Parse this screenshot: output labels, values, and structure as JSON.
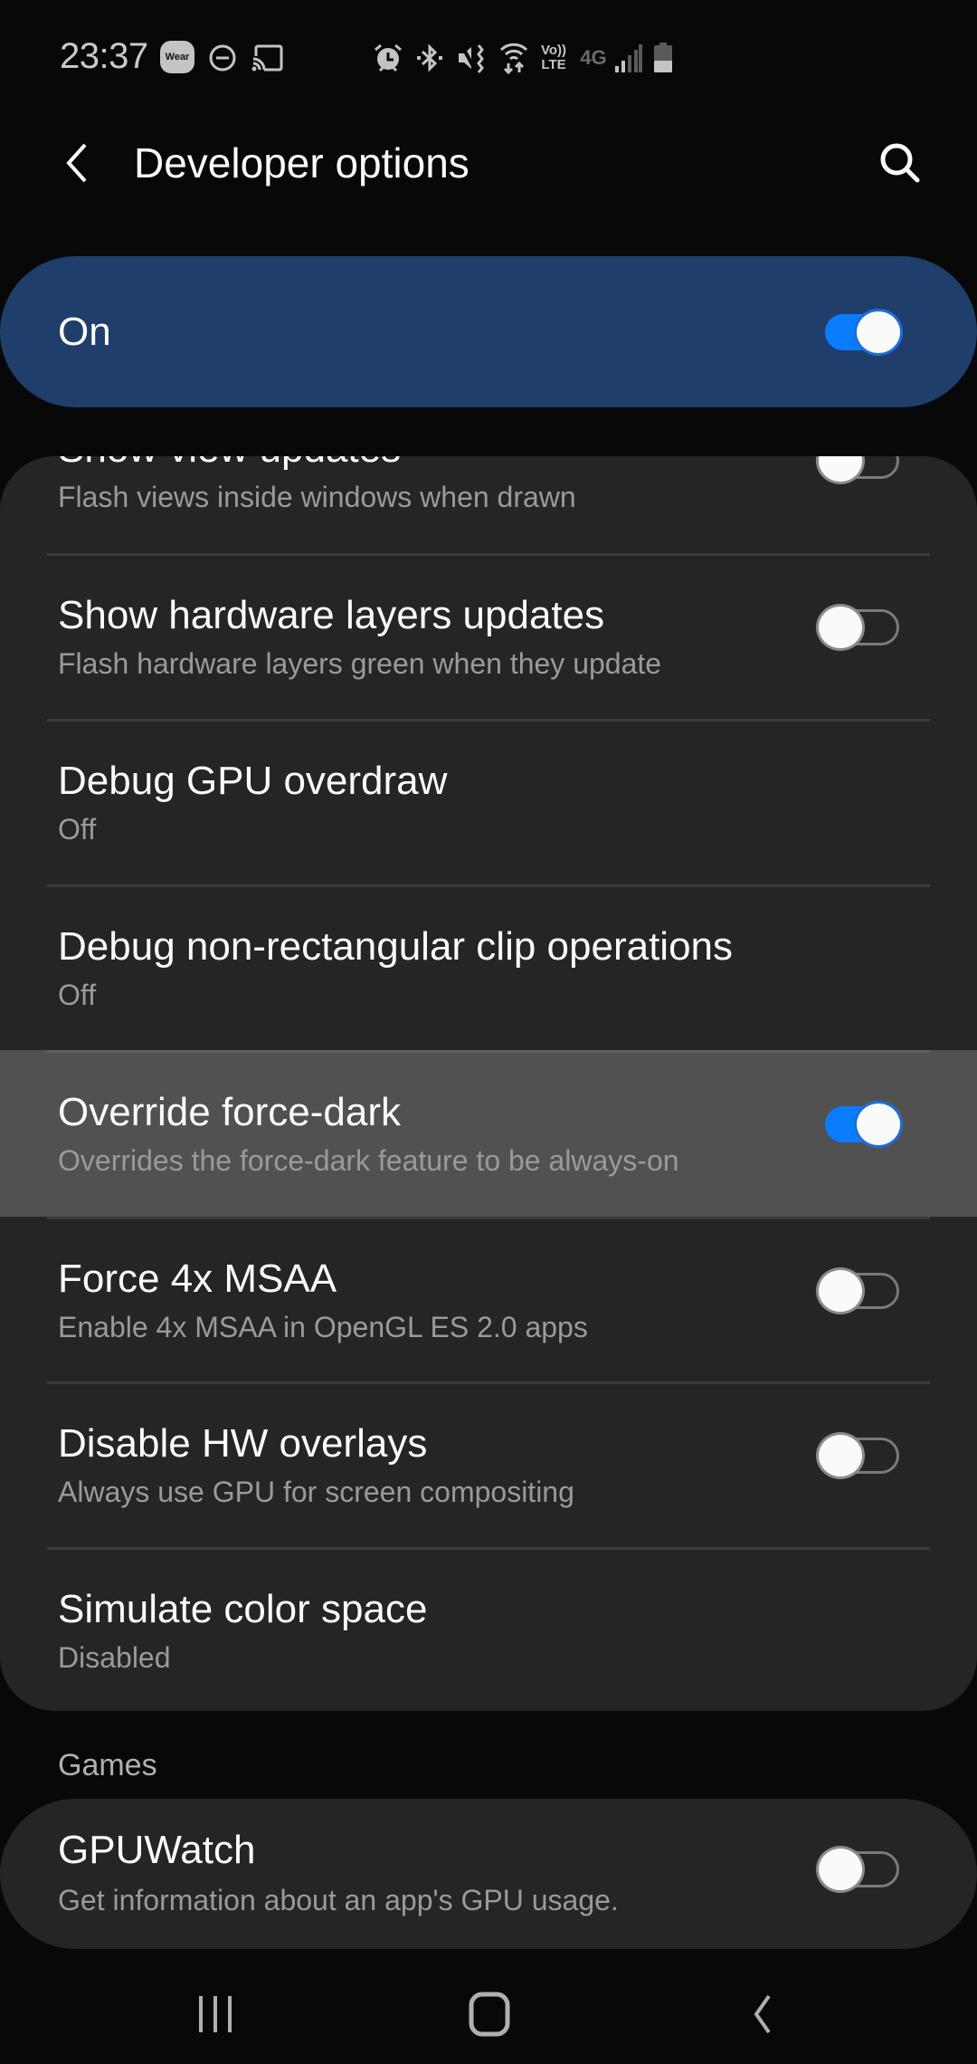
{
  "status_bar": {
    "time": "23:37",
    "wear_badge": "Wear",
    "icons": [
      "wear-icon",
      "do-not-disturb-icon",
      "cast-icon",
      "alarm-icon",
      "bluetooth-icon",
      "vibrate-mute-icon",
      "wifi-icon",
      "volte-icon",
      "4g-lte-icon",
      "signal-icon",
      "battery-icon"
    ],
    "volte_top": "Vo))",
    "volte_bottom": "LTE",
    "network": "4G"
  },
  "header": {
    "title": "Developer options",
    "back_icon": "back-arrow-icon",
    "search_icon": "search-icon"
  },
  "master_switch": {
    "label": "On",
    "enabled": true
  },
  "settings": [
    {
      "title": "Show view updates",
      "subtitle": "Flash views inside windows when drawn",
      "toggle": "off"
    },
    {
      "title": "Show hardware layers updates",
      "subtitle": "Flash hardware layers green when they update",
      "toggle": "off"
    },
    {
      "title": "Debug GPU overdraw",
      "subtitle": "Off",
      "toggle": null
    },
    {
      "title": "Debug non-rectangular clip operations",
      "subtitle": "Off",
      "toggle": null
    },
    {
      "title": "Override force-dark",
      "subtitle": "Overrides the force-dark feature to be always-on",
      "toggle": "on",
      "highlighted": true
    },
    {
      "title": "Force 4x MSAA",
      "subtitle": "Enable 4x MSAA in OpenGL ES 2.0 apps",
      "toggle": "off"
    },
    {
      "title": "Disable HW overlays",
      "subtitle": "Always use GPU for screen compositing",
      "toggle": "off"
    },
    {
      "title": "Simulate color space",
      "subtitle": "Disabled",
      "toggle": null
    }
  ],
  "games_section": {
    "label": "Games",
    "items": [
      {
        "title": "GPUWatch",
        "subtitle": "Get information about an app's GPU usage.",
        "toggle": "off"
      }
    ]
  },
  "nav_bar": {
    "buttons": [
      "recents-icon",
      "home-icon",
      "back-icon"
    ]
  },
  "colors": {
    "background": "#080808",
    "master_card": "#1f3e6b",
    "card": "#252525",
    "highlight_row": "#515151",
    "accent": "#0a7dff",
    "subtitle": "#9a9a9a"
  }
}
